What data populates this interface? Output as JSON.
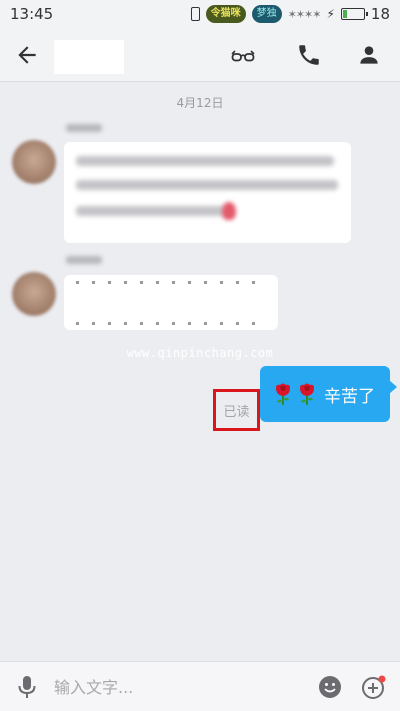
{
  "status_bar": {
    "time": "13:45",
    "battery_level": "18",
    "battery_fraction": 0.18,
    "badge_text": "令猫咪",
    "badge_text2": "梦独",
    "stars": "✶✶✶✶"
  },
  "header": {
    "back_icon": "arrow-left-icon",
    "icons": [
      "glasses-icon",
      "phone-icon",
      "person-icon"
    ]
  },
  "chat": {
    "date": "4月12日",
    "watermark": "www.qinpinchang.com",
    "outgoing": {
      "text": "辛苦了",
      "emoji": [
        "rose",
        "rose"
      ],
      "read_status": "已读"
    },
    "colors": {
      "outgoing_bubble": "#27a8f1",
      "highlight_border": "#d9161c",
      "background": "#ebedf1"
    }
  },
  "input_bar": {
    "placeholder": "输入文字...",
    "icons": [
      "microphone-icon",
      "emoji-icon",
      "plus-icon"
    ]
  }
}
